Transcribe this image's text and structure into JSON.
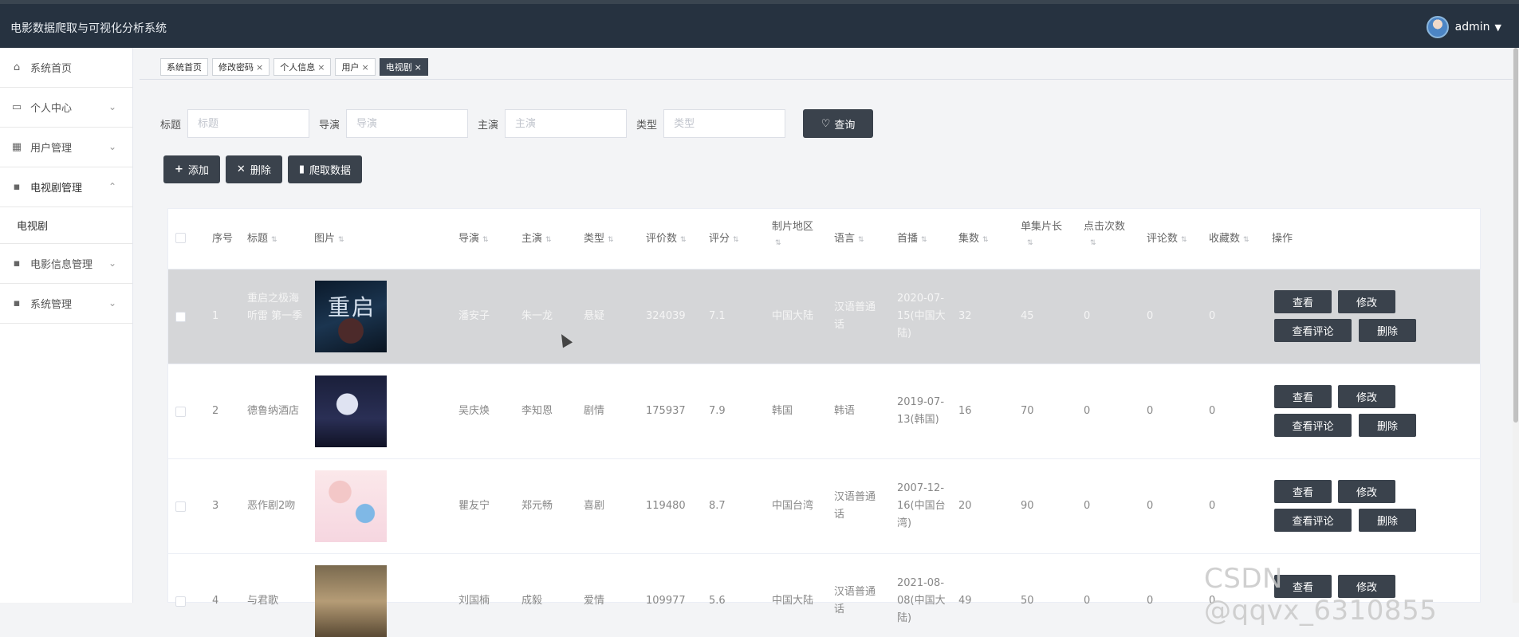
{
  "app": {
    "title": "电影数据爬取与可视化分析系统",
    "user": "admin"
  },
  "sidebar": {
    "items": [
      {
        "label": "系统首页",
        "icon": "home-icon"
      },
      {
        "label": "个人中心",
        "icon": "profile-icon"
      },
      {
        "label": "用户管理",
        "icon": "grid-icon"
      },
      {
        "label": "电视剧管理",
        "icon": "grid-icon"
      },
      {
        "label": "电影信息管理",
        "icon": "grid-icon"
      },
      {
        "label": "系统管理",
        "icon": "grid-icon"
      }
    ],
    "submenu": "电视剧"
  },
  "tabs": [
    {
      "label": "系统首页"
    },
    {
      "label": "修改密码",
      "close": "×"
    },
    {
      "label": "个人信息",
      "close": "×"
    },
    {
      "label": "用户",
      "close": "×"
    },
    {
      "label": "电视剧",
      "close": "×"
    }
  ],
  "filters": [
    {
      "label": "标题",
      "placeholder": "标题"
    },
    {
      "label": "导演",
      "placeholder": "导演"
    },
    {
      "label": "主演",
      "placeholder": "主演"
    },
    {
      "label": "类型",
      "placeholder": "类型"
    }
  ],
  "search_label": "查询",
  "actions": {
    "add": "添加",
    "delete": "删除",
    "crawl": "爬取数据"
  },
  "columns": [
    "序号",
    "标题",
    "图片",
    "导演",
    "主演",
    "类型",
    "评价数",
    "评分",
    "制片地区",
    "语言",
    "首播",
    "集数",
    "单集片长",
    "点击次数",
    "评论数",
    "收藏数",
    "操作"
  ],
  "ops": {
    "view": "查看",
    "edit": "修改",
    "comments": "查看评论",
    "delete": "删除"
  },
  "rows": [
    {
      "no": "1",
      "title": "重启之极海听雷 第一季",
      "poster_text": "重启",
      "director": "潘安子",
      "actor": "朱一龙",
      "genre": "悬疑",
      "votes": "324039",
      "score": "7.1",
      "region": "中国大陆",
      "language": "汉语普通话",
      "premiere": "2020-07-15(中国大陆)",
      "episodes": "32",
      "length": "45",
      "clicks": "0",
      "comments": "0",
      "favorites": "0"
    },
    {
      "no": "2",
      "title": "德鲁纳酒店",
      "poster_text": "",
      "director": "吴庆焕",
      "actor": "李知恩",
      "genre": "剧情",
      "votes": "175937",
      "score": "7.9",
      "region": "韩国",
      "language": "韩语",
      "premiere": "2019-07-13(韩国)",
      "episodes": "16",
      "length": "70",
      "clicks": "0",
      "comments": "0",
      "favorites": "0"
    },
    {
      "no": "3",
      "title": "恶作剧2吻",
      "poster_text": "",
      "director": "瞿友宁",
      "actor": "郑元畅",
      "genre": "喜剧",
      "votes": "119480",
      "score": "8.7",
      "region": "中国台湾",
      "language": "汉语普通话",
      "premiere": "2007-12-16(中国台湾)",
      "episodes": "20",
      "length": "90",
      "clicks": "0",
      "comments": "0",
      "favorites": "0"
    },
    {
      "no": "4",
      "title": "与君歌",
      "poster_text": "",
      "director": "刘国楠",
      "actor": "成毅",
      "genre": "爱情",
      "votes": "109977",
      "score": "5.6",
      "region": "中国大陆",
      "language": "汉语普通话",
      "premiere": "2021-08-08(中国大陆)",
      "episodes": "49",
      "length": "50",
      "clicks": "0",
      "comments": "0",
      "favorites": "0"
    }
  ],
  "watermark": "CSDN @qqvx_6310855"
}
